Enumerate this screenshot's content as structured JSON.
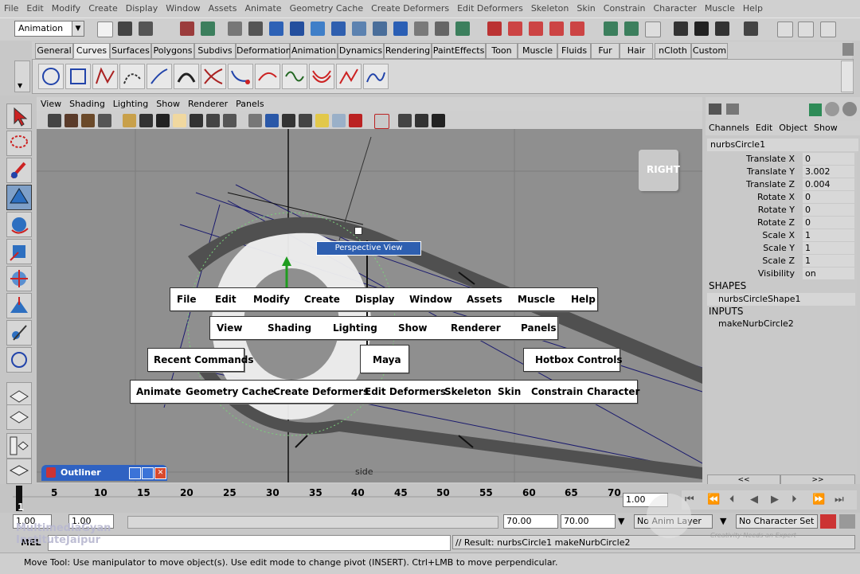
{
  "menubar": [
    "File",
    "Edit",
    "Modify",
    "Create",
    "Display",
    "Window",
    "Assets",
    "Animate",
    "Geometry Cache",
    "Create Deformers",
    "Edit Deformers",
    "Skeleton",
    "Skin",
    "Constrain",
    "Character",
    "Muscle",
    "Help"
  ],
  "status_line": {
    "mode": "Animation"
  },
  "shelf": {
    "tabs": [
      "General",
      "Curves",
      "Surfaces",
      "Polygons",
      "Subdivs",
      "Deformation",
      "Animation",
      "Dynamics",
      "Rendering",
      "PaintEffects",
      "Toon",
      "Muscle",
      "Fluids",
      "Fur",
      "Hair",
      "nCloth",
      "Custom"
    ],
    "active_tab": "Curves"
  },
  "panel_menu": [
    "View",
    "Shading",
    "Lighting",
    "Show",
    "Renderer",
    "Panels"
  ],
  "viewport": {
    "camera_label": "side",
    "view_cube_label": "RIGHT",
    "tooltip": "Perspective View"
  },
  "hotbox": {
    "row1": [
      "File",
      "Edit",
      "Modify",
      "Create",
      "Display",
      "Window",
      "Assets",
      "Muscle",
      "Help"
    ],
    "row2": [
      "View",
      "Shading",
      "Lighting",
      "Show",
      "Renderer",
      "Panels"
    ],
    "recent_commands": "Recent Commands",
    "center": "Maya",
    "hotbox_controls": "Hotbox Controls",
    "row3": [
      "Animate",
      "Geometry Cache",
      "Create Deformers",
      "Edit Deformers",
      "Skeleton",
      "Skin",
      "Constrain",
      "Character"
    ]
  },
  "channel_box": {
    "menu": [
      "Channels",
      "Edit",
      "Object",
      "Show"
    ],
    "object_name": "nurbsCircle1",
    "channels": [
      {
        "label": "Translate X",
        "value": "0"
      },
      {
        "label": "Translate Y",
        "value": "3.002"
      },
      {
        "label": "Translate Z",
        "value": "0.004"
      },
      {
        "label": "Rotate X",
        "value": "0"
      },
      {
        "label": "Rotate Y",
        "value": "0"
      },
      {
        "label": "Rotate Z",
        "value": "0"
      },
      {
        "label": "Scale X",
        "value": "1"
      },
      {
        "label": "Scale Y",
        "value": "1"
      },
      {
        "label": "Scale Z",
        "value": "1"
      },
      {
        "label": "Visibility",
        "value": "on"
      }
    ],
    "shapes_header": "SHAPES",
    "shape_name": "nurbsCircleShape1",
    "inputs_header": "INPUTS",
    "input_name": "makeNurbCircle2",
    "scroll_left": "<<",
    "scroll_right": ">>"
  },
  "outliner": {
    "title": "Outliner"
  },
  "time_slider": {
    "ticks": [
      "1",
      "5",
      "10",
      "15",
      "20",
      "25",
      "30",
      "35",
      "40",
      "45",
      "50",
      "55",
      "60",
      "65",
      "70"
    ],
    "current_frame_field": "1.00"
  },
  "range_slider": {
    "start": "1.00",
    "range_start": "1.00",
    "range_end": "70.00",
    "end": "70.00",
    "anim_layer": "No Anim Layer",
    "character_set": "No Character Set"
  },
  "command_line": {
    "label": "MEL",
    "result": "// Result: nurbsCircle1 makeNurbCircle2"
  },
  "help_line": "Move Tool: Use manipulator to move object(s). Use edit mode to change pivot (INSERT).  Ctrl+LMB to move perpendicular.",
  "watermark": {
    "line1": "MultimediaGyan",
    "line2": "InstituteJaipur",
    "right_tagline": "Creativity Needs an Expert"
  }
}
